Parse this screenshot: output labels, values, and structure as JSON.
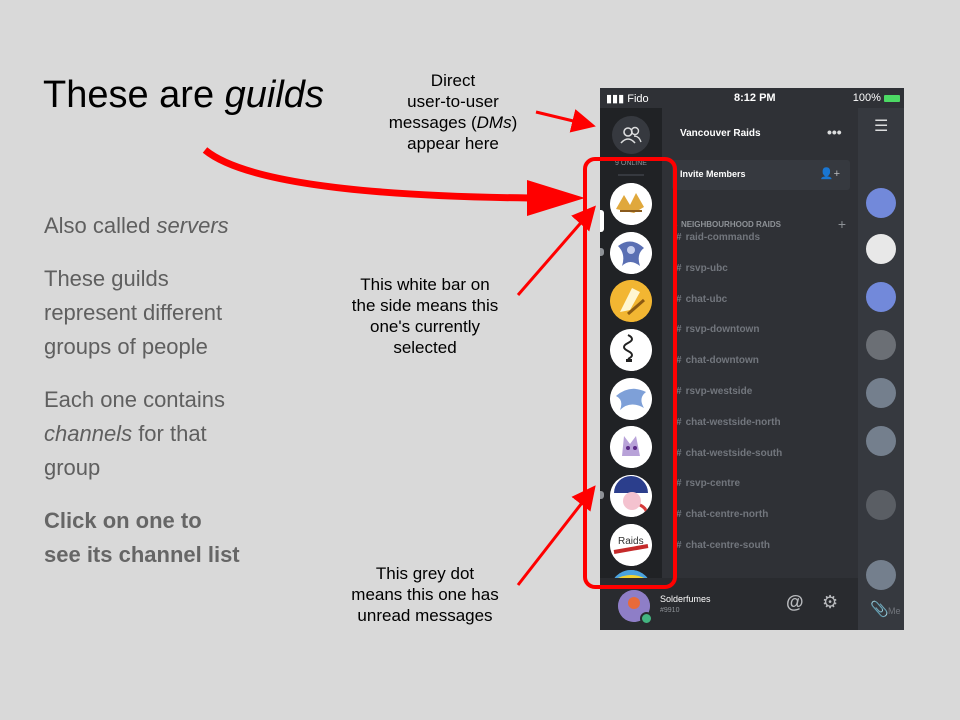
{
  "slide": {
    "title_plain": "These are ",
    "title_italic": "guilds",
    "bullets": {
      "b1_plain": "Also called ",
      "b1_italic": "servers",
      "b2_l1": "These guilds",
      "b2_l2": "represent different",
      "b2_l3": "groups of people",
      "b3_l1": "Each one contains",
      "b3_l2_italic": "channels",
      "b3_l2_plain": " for that",
      "b3_l3": "group",
      "b4_l1": "Click on one to",
      "b4_l2": "see its channel list"
    },
    "notes": {
      "dm_l1": "Direct",
      "dm_l2": "user-to-user",
      "dm_l3_plain": "messages (",
      "dm_l3_italic": "DMs",
      "dm_l3_end": ")",
      "dm_l4": "appear here",
      "bar_l1": "This white bar on",
      "bar_l2": "the side means this",
      "bar_l3": "one's currently",
      "bar_l4": "selected",
      "dot_l1": "This grey dot",
      "dot_l2": "means this one has",
      "dot_l3": "unread messages"
    }
  },
  "phone": {
    "status": {
      "carrier": "Fido",
      "time": "8:12 PM",
      "battery": "100%"
    },
    "online_count": "9 ONLINE",
    "server_name": "Vancouver Raids",
    "more_icon": "•••",
    "invite_label": "Invite Members",
    "category": "NEIGHBOURHOOD RAIDS",
    "channels": [
      "raid-commands",
      "rsvp-ubc",
      "chat-ubc",
      "rsvp-downtown",
      "chat-downtown",
      "rsvp-westside",
      "chat-westside-north",
      "chat-westside-south",
      "rsvp-centre",
      "chat-centre-north",
      "chat-centre-south"
    ],
    "guild_avatars": [
      "alakazam-icon",
      "lugia-icon",
      "pikachu-tail-icon",
      "solderfumes-logo",
      "articuno-icon",
      "mewtwo-icon",
      "pokeball-mascot-icon",
      "raids-toronto-icon",
      "striped-icon"
    ],
    "user": {
      "name": "Solderfumes",
      "tag": "#9910"
    },
    "message_placeholder": "Me",
    "colors": {
      "rail": "#202225",
      "panel": "#2f3136",
      "chat": "#36393f",
      "blurple": "#7289da",
      "annotation_red": "#ff0000"
    }
  }
}
